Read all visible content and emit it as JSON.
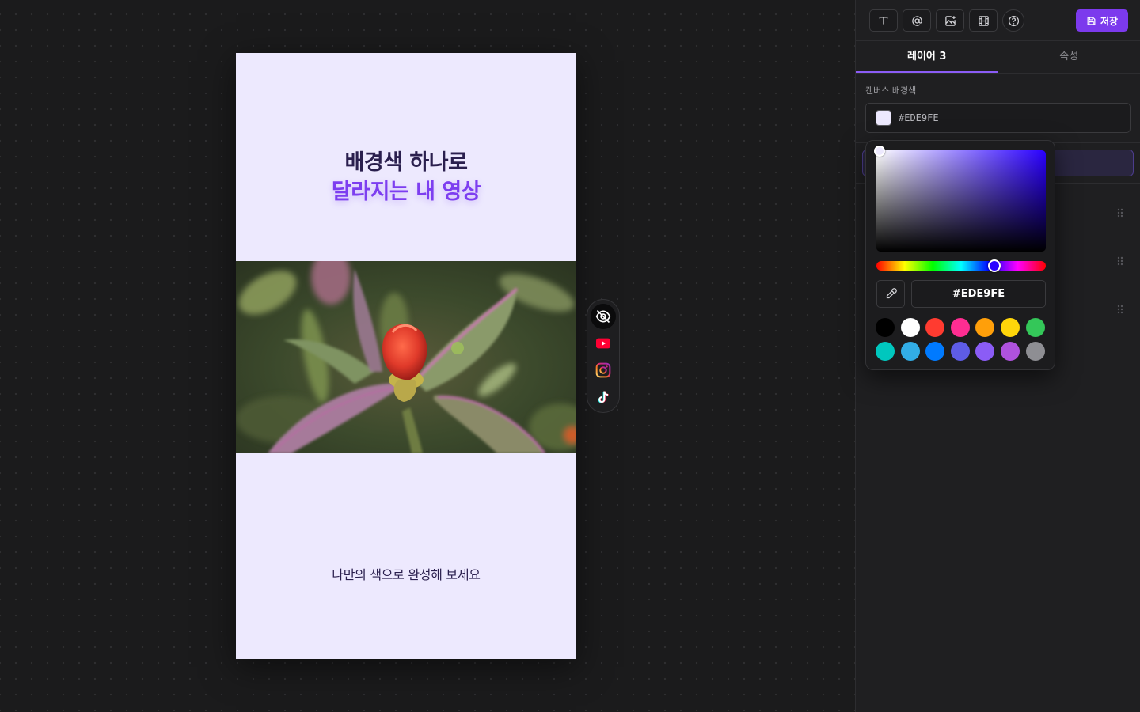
{
  "canvas": {
    "background_color": "#EDE9FE",
    "headline_line1": "배경색 하나로",
    "headline_line2": "달라지는 내 영상",
    "subline": "나만의 색으로 완성해 보세요",
    "image_alt": "red flower bud with purple-edged leaves"
  },
  "platform_bar": {
    "items": [
      {
        "name": "hide",
        "icon": "eye-off-icon"
      },
      {
        "name": "youtube",
        "icon": "youtube-icon"
      },
      {
        "name": "instagram",
        "icon": "instagram-icon"
      },
      {
        "name": "tiktok",
        "icon": "tiktok-icon"
      }
    ]
  },
  "toolbar": {
    "tools": [
      {
        "name": "text",
        "icon": "text-icon"
      },
      {
        "name": "mention",
        "icon": "at-sign-icon"
      },
      {
        "name": "image",
        "icon": "image-add-icon"
      },
      {
        "name": "video",
        "icon": "film-icon"
      },
      {
        "name": "help",
        "icon": "help-icon"
      }
    ],
    "save_label": "저장",
    "accent": "#7C3AED"
  },
  "tabs": [
    {
      "label": "레이어 3",
      "active": true
    },
    {
      "label": "속성",
      "active": false
    }
  ],
  "background_section": {
    "label": "캔버스 배경색",
    "value": "#EDE9FE"
  },
  "color_picker": {
    "hex": "#EDE9FE",
    "swatches": [
      "#000000",
      "#FFFFFF",
      "#FF3B30",
      "#FF2D92",
      "#FF9F0A",
      "#FFD60A",
      "#34C759",
      "#00C7BE",
      "#32ADE6",
      "#007AFF",
      "#5E5CE6",
      "#8B5CF6",
      "#AF52DE",
      "#8E8E93"
    ]
  }
}
